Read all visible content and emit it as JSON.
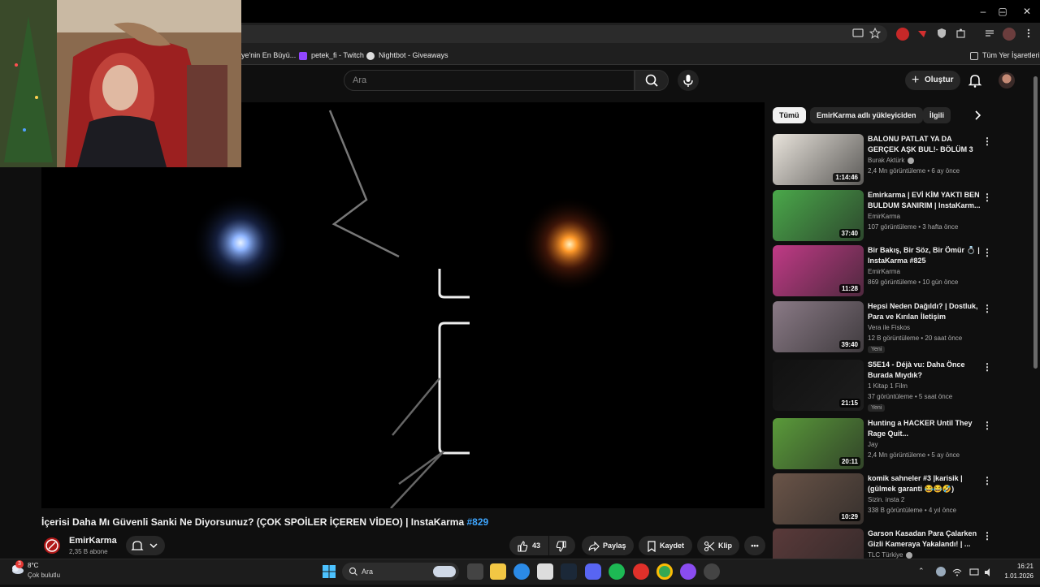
{
  "browser": {
    "bookmarks": [
      {
        "label": "ye'nin En Büyü..."
      },
      {
        "label": "petek_fi - Twitch"
      },
      {
        "label": "Nightbot - Giveaways"
      }
    ],
    "all_bookmarks": "Tüm Yer İşaretleri",
    "window_min": "–",
    "window_max": "▢",
    "window_close": "✕"
  },
  "youtube": {
    "search_placeholder": "Ara",
    "create_label": "Oluştur"
  },
  "video": {
    "title": "İçerisi Daha Mı Güvenli Sanki Ne Diyorsunuz? (ÇOK SPOİLER İÇEREN VİDEO) | InstaKarma",
    "hashtag": "#829",
    "channel": "EmirKarma",
    "subscribers": "2,35 B abone",
    "likes": "43",
    "share_label": "Paylaş",
    "save_label": "Kaydet",
    "clip_label": "Klip"
  },
  "chips": [
    "Tümü",
    "EmirKarma adlı yükleyiciden",
    "İlgili"
  ],
  "recommendations": [
    {
      "title": "BALONU PATLAT YA DA GERÇEK AŞK BUL!- BÖLÜM 3",
      "channel": "Burak Aktürk",
      "verified": true,
      "meta": "2,4 Mn görüntüleme • 6 ay önce",
      "duration": "1:14:46",
      "thumb_color": "#e9e4dc",
      "badge": ""
    },
    {
      "title": "Emirkarma | EVİ KİM YAKTI BEN BULDUM SANIRIM | InstaKarm...",
      "channel": "EmirKarma",
      "verified": false,
      "meta": "107 görüntüleme • 3 hafta önce",
      "duration": "37:40",
      "thumb_color": "#4aa84a",
      "badge": ""
    },
    {
      "title": "Bir Bakış, Bir Söz, Bir Ömür 💍 | InstaKarma #825",
      "channel": "EmirKarma",
      "verified": false,
      "meta": "869 görüntüleme • 10 gün önce",
      "duration": "11:28",
      "thumb_color": "#c03a86",
      "badge": ""
    },
    {
      "title": "Hepsi Neden Dağıldı? | Dostluk, Para ve Kırılan İletişim",
      "channel": "Vera ile Fiskos",
      "verified": false,
      "meta": "12 B görüntüleme • 20 saat önce",
      "duration": "39:40",
      "thumb_color": "#8a7a86",
      "badge": "Yeni"
    },
    {
      "title": "S5E14 - Déjà vu: Daha Önce Burada Mıydık?",
      "channel": "1 Kitap 1 Film",
      "verified": false,
      "meta": "37 görüntüleme • 5 saat önce",
      "duration": "21:15",
      "thumb_color": "#111111",
      "badge": "Yeni"
    },
    {
      "title": "Hunting a HACKER Until They Rage Quit...",
      "channel": "Jay",
      "verified": false,
      "meta": "2,4 Mn görüntüleme • 5 ay önce",
      "duration": "20:11",
      "thumb_color": "#5a9a3a",
      "badge": ""
    },
    {
      "title": "komik sahneler #3 |karisik | (gülmek garanti 😂😂🤣)",
      "channel": "Sizin. insta 2",
      "verified": false,
      "meta": "338 B görüntüleme • 4 yıl önce",
      "duration": "10:29",
      "thumb_color": "#6a5448",
      "badge": ""
    },
    {
      "title": "Garson Kasadan Para Çalarken Gizli Kameraya Yakalandı! | ...",
      "channel": "TLC Türkiye",
      "verified": true,
      "meta": "",
      "duration": "",
      "thumb_color": "#5a3a3a",
      "badge": ""
    }
  ],
  "taskbar": {
    "weather_temp": "8°C",
    "weather_desc": "Çok bulutlu",
    "weather_badge": "3",
    "search_label": "Ara",
    "time": "16:21",
    "date": "1.01.2026"
  }
}
